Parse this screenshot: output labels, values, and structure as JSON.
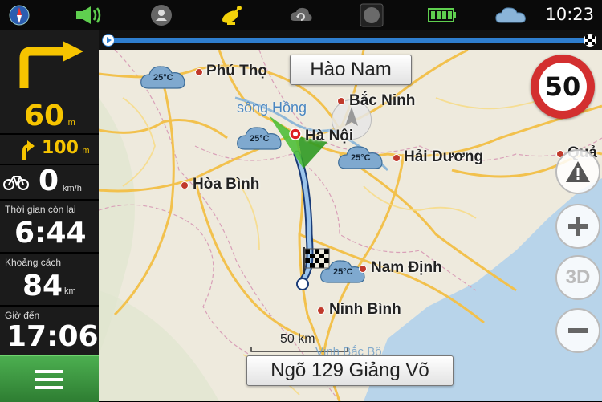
{
  "status_bar": {
    "icons": [
      "compass-icon",
      "volume-icon",
      "profile-pin-icon",
      "satellite-icon",
      "sync-icon",
      "record-icon",
      "battery-icon",
      "weather-cloud-icon"
    ],
    "time": "10:23"
  },
  "side_panel": {
    "turn_distance": "60",
    "turn_unit": "m",
    "next_turn_distance": "100",
    "next_turn_unit": "m",
    "speed_value": "0",
    "speed_unit": "km/h",
    "remaining_time_label": "Thời gian còn lại",
    "remaining_time": "6:44",
    "distance_label": "Khoảng cách",
    "distance_value": "84",
    "distance_unit": "km",
    "arrival_label": "Giờ đến",
    "arrival_time": "17:06"
  },
  "map": {
    "road_name_top": "Hào Nam",
    "road_name_bottom": "Ngõ 129 Giảng Võ",
    "speed_limit": "50",
    "scale_label": "50 km",
    "river_label": "sông Hồng",
    "faded_label": "Vịnh Bắc Bộ",
    "cities": [
      {
        "name": "Phú Thọ"
      },
      {
        "name": "Bắc Ninh"
      },
      {
        "name": "Hà Nội"
      },
      {
        "name": "Hải Dương"
      },
      {
        "name": "Hòa Bình"
      },
      {
        "name": "Nam Định"
      },
      {
        "name": "Ninh Bình"
      },
      {
        "name": "Quả"
      }
    ],
    "weather": [
      {
        "temp": "25°C"
      },
      {
        "temp": "25°C"
      },
      {
        "temp": "25°C"
      },
      {
        "temp": "25°C"
      }
    ],
    "buttons": {
      "zoom_in": "+",
      "zoom_out": "−",
      "view_3d": "3D",
      "warning": "!"
    }
  },
  "colors": {
    "accent_yellow": "#f6c400",
    "menu_green": "#43a047",
    "route_blue": "#7fb6e6",
    "speed_red": "#d32f2f"
  }
}
